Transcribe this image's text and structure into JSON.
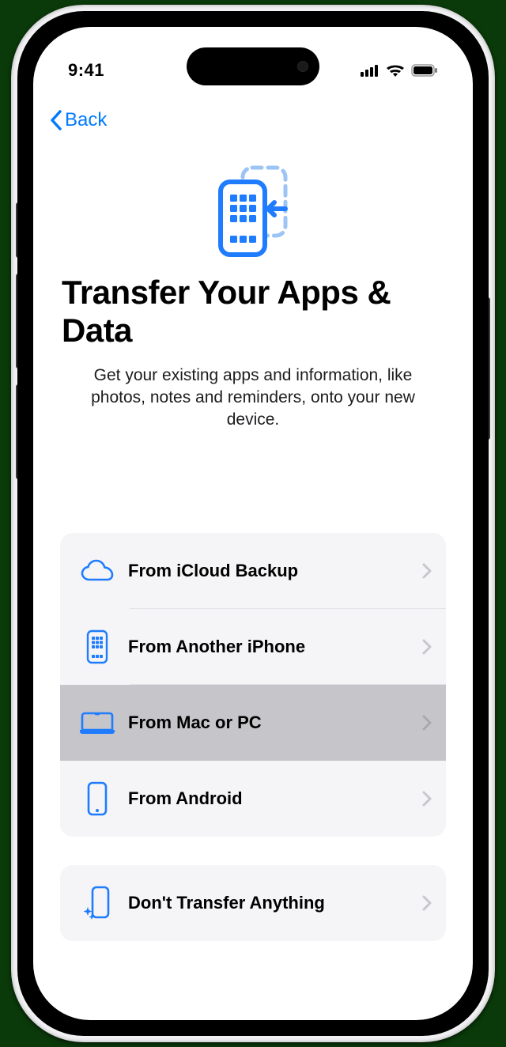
{
  "status": {
    "time": "9:41"
  },
  "nav": {
    "back_label": "Back"
  },
  "page": {
    "title": "Transfer Your Apps & Data",
    "subtitle": "Get your existing apps and information, like photos, notes and reminders, onto your new device."
  },
  "colors": {
    "accent": "#007aff"
  },
  "options": {
    "group1": [
      {
        "icon": "cloud-icon",
        "label": "From iCloud Backup",
        "selected": false
      },
      {
        "icon": "iphone-icon",
        "label": "From Another iPhone",
        "selected": false
      },
      {
        "icon": "laptop-icon",
        "label": "From Mac or PC",
        "selected": true
      },
      {
        "icon": "android-icon",
        "label": "From Android",
        "selected": false
      }
    ],
    "group2": [
      {
        "icon": "sparkle-phone-icon",
        "label": "Don't Transfer Anything",
        "selected": false
      }
    ]
  }
}
